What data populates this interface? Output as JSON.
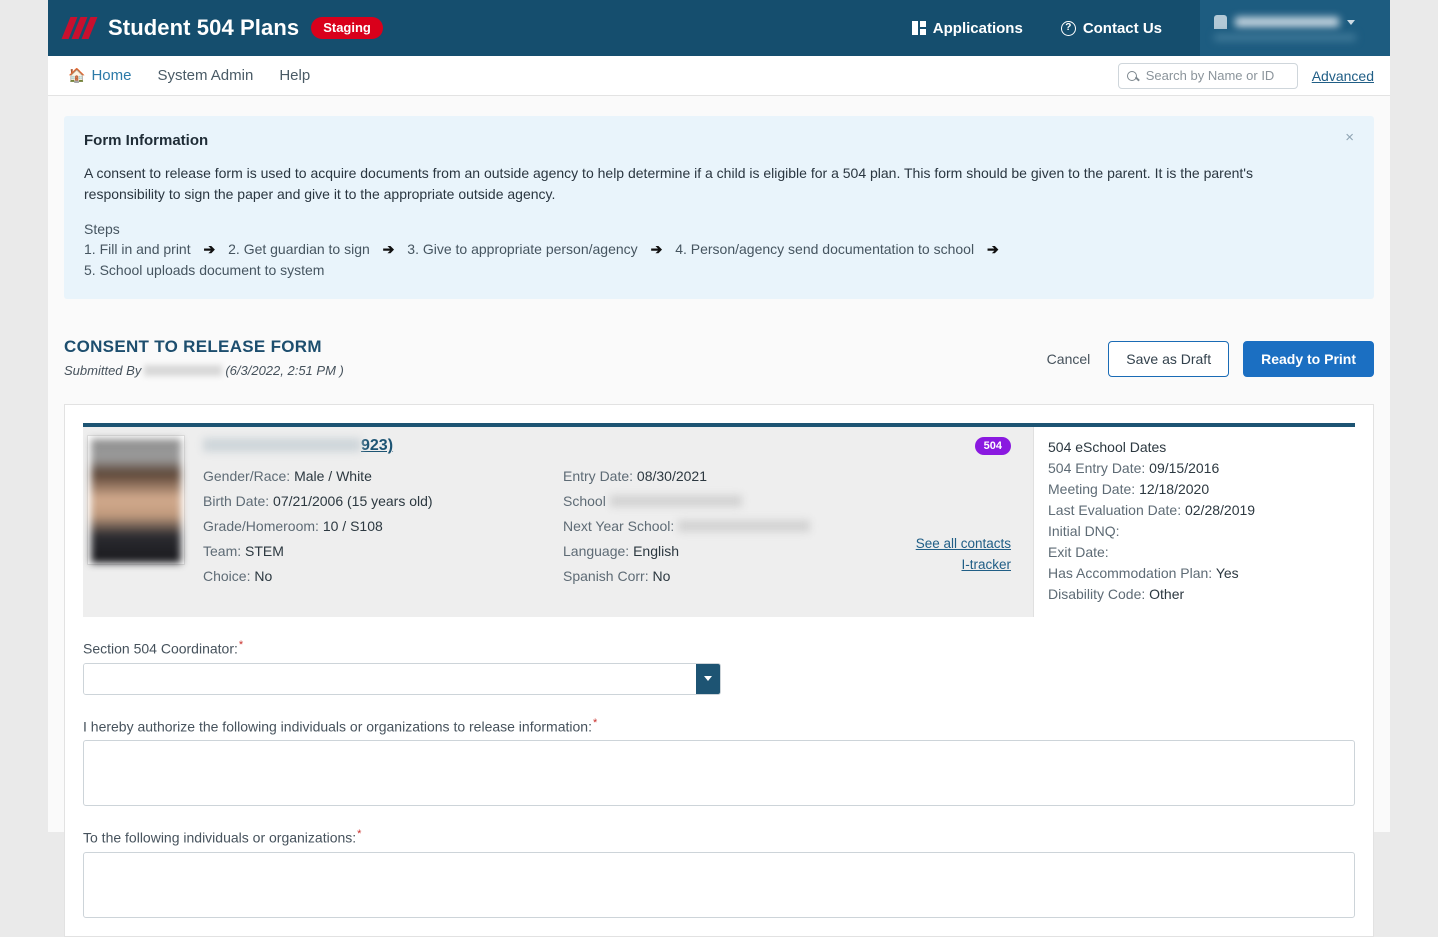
{
  "brand": {
    "title": "Student 504 Plans",
    "env_badge": "Staging",
    "applications_label": "Applications",
    "contact_label": "Contact Us"
  },
  "nav": {
    "items": [
      {
        "label": "Home",
        "icon": "home-icon"
      },
      {
        "label": "System Admin",
        "icon": ""
      },
      {
        "label": "Help",
        "icon": ""
      }
    ],
    "search_placeholder": "Search by Name or ID",
    "search_value": "",
    "advanced_label": "Advanced"
  },
  "info_panel": {
    "heading": "Form Information",
    "body": "A consent to release form is used to acquire documents from an outside agency to help determine if a child is eligible for a 504 plan. This form should be given to the parent. It is the parent's responsibility to sign the paper and give it to the appropriate outside agency.",
    "steps_label": "Steps",
    "steps": [
      "1. Fill in and print",
      "2. Get guardian to sign",
      "3. Give to appropriate person/agency",
      "4. Person/agency send documentation to school",
      "5. School uploads document to system"
    ],
    "arrow": "➔",
    "close_label": "×"
  },
  "form_header": {
    "title": "CONSENT TO RELEASE FORM",
    "submitted_prefix": "Submitted By",
    "submitted_by": "",
    "submitted_date": "(6/3/2022, 2:51 PM )",
    "cancel_label": "Cancel",
    "save_draft_label": "Save as Draft",
    "ready_print_label": "Ready to Print"
  },
  "student": {
    "name": "",
    "id_suffix": "923)",
    "badge": "504",
    "left_rows": [
      {
        "label": "Gender/Race:",
        "value": "Male / White"
      },
      {
        "label": "Birth Date:",
        "value": "07/21/2006 (15 years old)"
      },
      {
        "label": "Grade/Homeroom:",
        "value": "10 / S108"
      },
      {
        "label": "Team:",
        "value": "STEM"
      },
      {
        "label": "Choice:",
        "value": "No"
      }
    ],
    "mid_rows": [
      {
        "label": "Entry Date:",
        "value": "08/30/2021",
        "redacted": false
      },
      {
        "label": "School",
        "value": "",
        "redacted": true
      },
      {
        "label": "Next Year School:",
        "value": "",
        "redacted": true
      },
      {
        "label": "Language:",
        "value": "English",
        "redacted": false
      },
      {
        "label": "Spanish Corr:",
        "value": "No",
        "redacted": false
      }
    ],
    "links": [
      {
        "label": "See all contacts"
      },
      {
        "label": "I-tracker"
      }
    ],
    "eschool": {
      "title": "504 eSchool Dates",
      "rows": [
        {
          "label": "504 Entry Date:",
          "value": "09/15/2016"
        },
        {
          "label": "Meeting Date:",
          "value": "12/18/2020"
        },
        {
          "label": "Last Evaluation Date:",
          "value": "02/28/2019"
        },
        {
          "label": "Initial DNQ:",
          "value": ""
        },
        {
          "label": "Exit Date:",
          "value": ""
        },
        {
          "label": "Has Accommodation Plan:",
          "value": "Yes"
        },
        {
          "label": "Disability Code:",
          "value": "Other"
        }
      ]
    }
  },
  "fields": {
    "coordinator_label": "Section 504 Coordinator:",
    "coordinator_value": "",
    "authorize_label": "I hereby authorize the following individuals or organizations to release information:",
    "authorize_value": "",
    "to_label": "To the following individuals or organizations:",
    "to_value": "",
    "required_mark": "*"
  },
  "colors": {
    "brand_bar": "#154e6e",
    "staging_badge": "#d9001b",
    "primary_button": "#1b6fc2",
    "badge_504": "#8a19e0",
    "info_panel": "#e9f4fb"
  }
}
